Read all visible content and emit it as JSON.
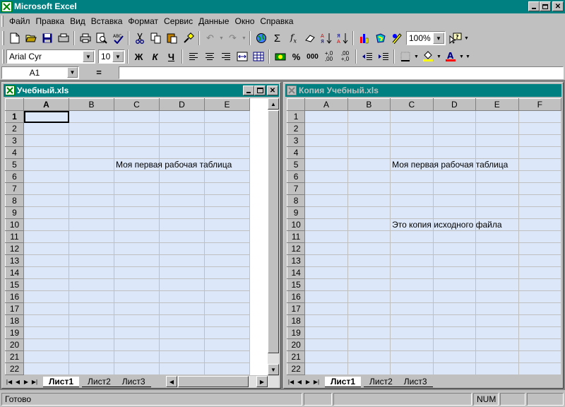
{
  "app": {
    "title": "Microsoft Excel"
  },
  "menu": [
    {
      "label": "Файл"
    },
    {
      "label": "Правка"
    },
    {
      "label": "Вид"
    },
    {
      "label": "Вставка"
    },
    {
      "label": "Формат"
    },
    {
      "label": "Сервис"
    },
    {
      "label": "Данные"
    },
    {
      "label": "Окно"
    },
    {
      "label": "Справка"
    }
  ],
  "toolbar": {
    "zoom": "100%"
  },
  "format": {
    "font_name": "Arial Cyr",
    "font_size": "10",
    "bold": "Ж",
    "italic": "К",
    "underline": "Ч",
    "percent": "%",
    "thousands": "000",
    "inc_decimal": "+,0 ,00",
    "dec_decimal": ",00 +,0"
  },
  "formula": {
    "namebox": "A1",
    "equals": "="
  },
  "left_window": {
    "title": "Учебный.xls",
    "columns": [
      "A",
      "B",
      "C",
      "D",
      "E"
    ],
    "rows": [
      "1",
      "2",
      "3",
      "4",
      "5",
      "6",
      "7",
      "8",
      "9",
      "10",
      "11",
      "12",
      "13",
      "14",
      "15",
      "16",
      "17",
      "18",
      "19",
      "20",
      "21",
      "22"
    ],
    "cells": {
      "C5": "Моя первая рабочая таблица"
    }
  },
  "right_window": {
    "title": "Копия Учебный.xls",
    "columns": [
      "A",
      "B",
      "C",
      "D",
      "E",
      "F"
    ],
    "rows": [
      "1",
      "2",
      "3",
      "4",
      "5",
      "6",
      "7",
      "8",
      "9",
      "10",
      "11",
      "12",
      "13",
      "14",
      "15",
      "16",
      "17",
      "18",
      "19",
      "20",
      "21",
      "22"
    ],
    "cells": {
      "C5": "Моя первая рабочая таблица",
      "C10": "Это копия исходного файла"
    }
  },
  "sheets": [
    "Лист1",
    "Лист2",
    "Лист3"
  ],
  "status": {
    "text": "Готово",
    "num": "NUM"
  },
  "colors": {
    "titlebar": "#008080",
    "cell_bg": "#dce8fa",
    "face": "#c0c0c0"
  }
}
